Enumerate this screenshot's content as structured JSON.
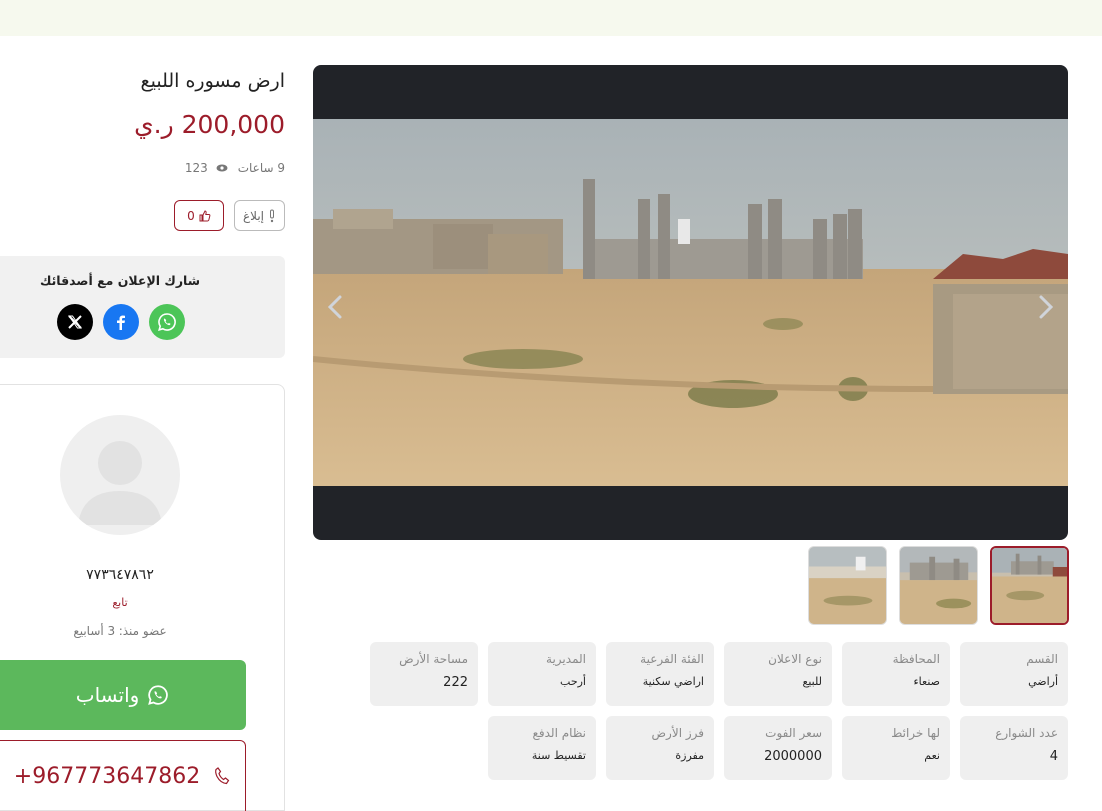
{
  "listing": {
    "title": "ارض مسوره اللبيع",
    "price": "200,000 ر.ي",
    "time_ago": "9 ساعات",
    "views": "123",
    "report_label": "إبلاغ",
    "likes": "0"
  },
  "share": {
    "label": "شارك الإعلان مع أصدقائك",
    "icons": [
      "whatsapp-icon",
      "facebook-icon",
      "x-icon"
    ],
    "colors": {
      "whatsapp": "#4cc558",
      "facebook": "#1877f2",
      "x": "#000000"
    }
  },
  "seller": {
    "name": "٧٧٣٦٤٧٨٦٢",
    "follow_label": "تابع",
    "member_since_label": "عضو منذ:",
    "member_since_value": "3 أسابيع",
    "whatsapp_label": "واتساب",
    "phone": "+967773647862"
  },
  "attributes": [
    {
      "key": "القسم",
      "value": "أراضي"
    },
    {
      "key": "المحافظة",
      "value": "صنعاء"
    },
    {
      "key": "نوع الاعلان",
      "value": "للبيع"
    },
    {
      "key": "الفئة الفرعية",
      "value": "اراضي سكنية"
    },
    {
      "key": "المديرية",
      "value": "أرحب"
    },
    {
      "key": "مساحة الأرض",
      "value": "222"
    },
    {
      "key": "عدد الشوارع",
      "value": "4"
    },
    {
      "key": "لها خرائط",
      "value": "نعم"
    },
    {
      "key": "سعر الفوت",
      "value": "2000000"
    },
    {
      "key": "فرز الأرض",
      "value": "مفرزة"
    },
    {
      "key": "نظام الدفع",
      "value": "تقسيط سنة"
    }
  ],
  "gallery": {
    "thumbnail_count": 3,
    "active_thumbnail": 1
  },
  "colors": {
    "accent": "#9c1c2a",
    "whatsapp_button": "#5cb85c",
    "gallery_bg": "#212328"
  }
}
